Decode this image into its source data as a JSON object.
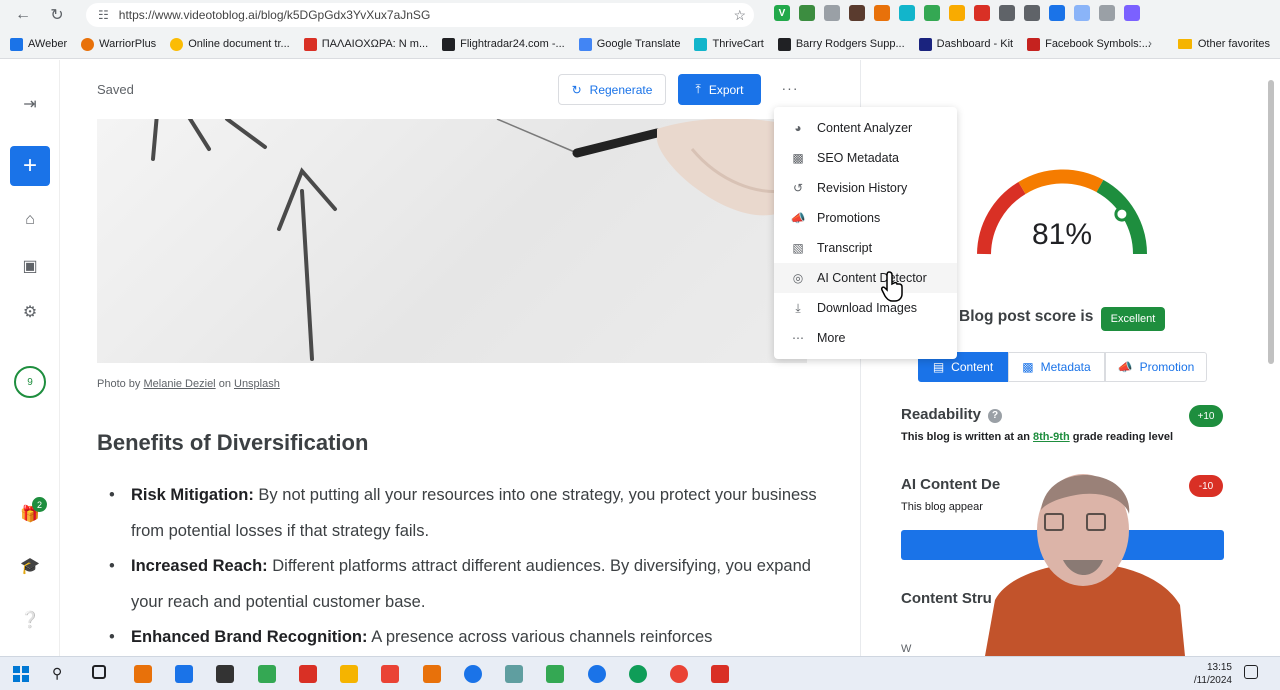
{
  "browser": {
    "url": "https://www.videotoblog.ai/blog/k5DGpGdx3YvXux7aJnSG",
    "bookmarks": [
      "AWeber",
      "WarriorPlus",
      "Online document tr...",
      "ΠΑΛΑΙΟΧΩΡΑ: Ν m...",
      "Flightradar24.com -...",
      "Google Translate",
      "ThriveCart",
      "Barry Rodgers Supp...",
      "Dashboard - Kit",
      "Facebook Symbols:..."
    ],
    "other_favorites": "Other favorites"
  },
  "rail": {
    "notif_count": "9",
    "gift_badge": "2"
  },
  "toolbar": {
    "saved": "Saved",
    "regenerate": "Regenerate",
    "export": "Export",
    "more": "···"
  },
  "article": {
    "photo_by": "Photo by ",
    "photographer": "Melanie Deziel",
    "on": " on ",
    "source": "Unsplash",
    "heading": "Benefits of Diversification",
    "bullets": [
      {
        "term": "Risk Mitigation:",
        "text": " By not putting all your resources into one strategy, you protect your business from potential losses if that strategy fails."
      },
      {
        "term": "Increased Reach:",
        "text": " Different platforms attract different audiences. By diversifying, you expand your reach and potential customer base."
      },
      {
        "term": "Enhanced Brand Recognition:",
        "text": " A presence across various channels reinforces"
      }
    ]
  },
  "menu": {
    "items": [
      {
        "label": "Content Analyzer",
        "icon": "gauge-icon"
      },
      {
        "label": "SEO Metadata",
        "icon": "laptop-icon"
      },
      {
        "label": "Revision History",
        "icon": "history-icon"
      },
      {
        "label": "Promotions",
        "icon": "megaphone-icon"
      },
      {
        "label": "Transcript",
        "icon": "transcript-icon"
      },
      {
        "label": "AI Content Detector",
        "icon": "target-icon"
      },
      {
        "label": "Download Images",
        "icon": "download-icon"
      },
      {
        "label": "More",
        "icon": "more-icon"
      }
    ]
  },
  "score": {
    "value": "81%",
    "fraction": 0.81,
    "label": "Blog post score is",
    "badge": "Excellent"
  },
  "tabs": [
    {
      "label": "Content"
    },
    {
      "label": "Metadata"
    },
    {
      "label": "Promotion"
    }
  ],
  "readability": {
    "title": "Readability",
    "points": "+10",
    "text_pre": "This blog is written at an ",
    "grade": "8th-9th",
    "text_post": " grade reading level"
  },
  "ai_detector": {
    "title": "AI Content De",
    "points": "-10",
    "text": "This blog appear",
    "link": "AI"
  },
  "structure": {
    "title": "Content Stru",
    "partial": "W"
  },
  "taskbar": {
    "time": "13:15",
    "date": "/11/2024"
  },
  "colors": {
    "primary": "#1a73e8",
    "success": "#1e8e3e",
    "danger": "#d93025",
    "gauge_orange": "#f57c00"
  }
}
